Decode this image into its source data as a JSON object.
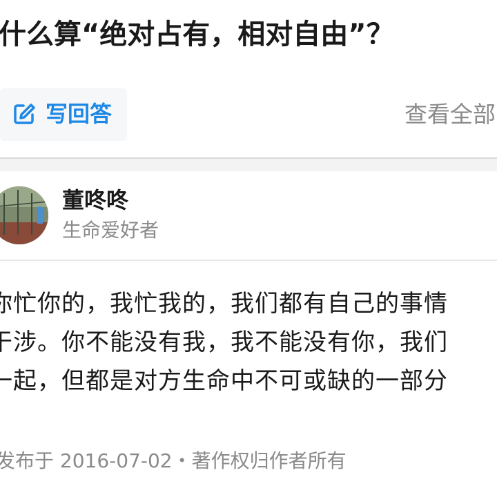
{
  "question": {
    "title": "什么算“绝对占有，相对自由”？"
  },
  "actions": {
    "write_answer_label": "写回答",
    "view_all_label": "查看全部"
  },
  "answer": {
    "author": {
      "name": "董咚咚",
      "bio": "生命爱好者"
    },
    "lines": [
      "你忙你的，我忙我的，我们都有自己的事情",
      "干涉。你不能没有我，我不能没有你，我们",
      "一起，但都是对方生命中不可或缺的一部分"
    ],
    "meta": "发布于 2016-07-02・著作权归作者所有"
  },
  "colors": {
    "accent": "#1e88e5",
    "text_primary": "#1a1a1a",
    "text_secondary": "#8a8a8a",
    "divider": "#f3f3f3"
  },
  "icons": {
    "write_answer": "edit-icon",
    "avatar": "avatar-photo"
  }
}
